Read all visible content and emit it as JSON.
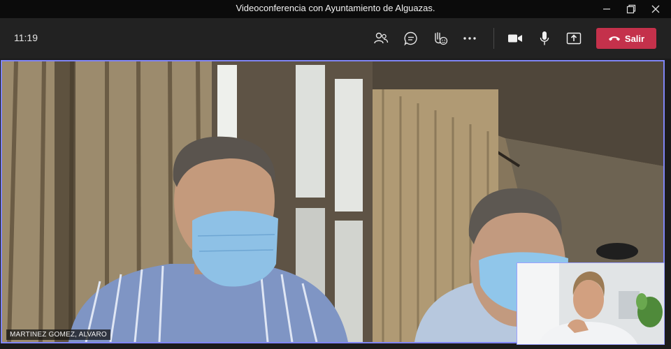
{
  "window": {
    "title": "Videoconferencia con Ayuntamiento de Alguazas.",
    "controls": [
      "minimize-icon",
      "restore-icon",
      "close-icon"
    ]
  },
  "toolbar": {
    "clock": "11:19",
    "buttons": [
      {
        "name": "participants",
        "icon": "people-icon"
      },
      {
        "name": "chat",
        "icon": "chat-icon"
      },
      {
        "name": "reactions",
        "icon": "reactions-icon"
      },
      {
        "name": "more",
        "icon": "more-icon"
      },
      {
        "name": "camera",
        "icon": "camera-icon"
      },
      {
        "name": "microphone",
        "icon": "microphone-icon"
      },
      {
        "name": "share",
        "icon": "share-icon"
      }
    ],
    "leave_label": "Salir",
    "leave_color": "#c4314b"
  },
  "main_video": {
    "participant_name": "MARTINEZ GOMEZ, ALVARO",
    "active_border_color": "#7f85f5"
  }
}
